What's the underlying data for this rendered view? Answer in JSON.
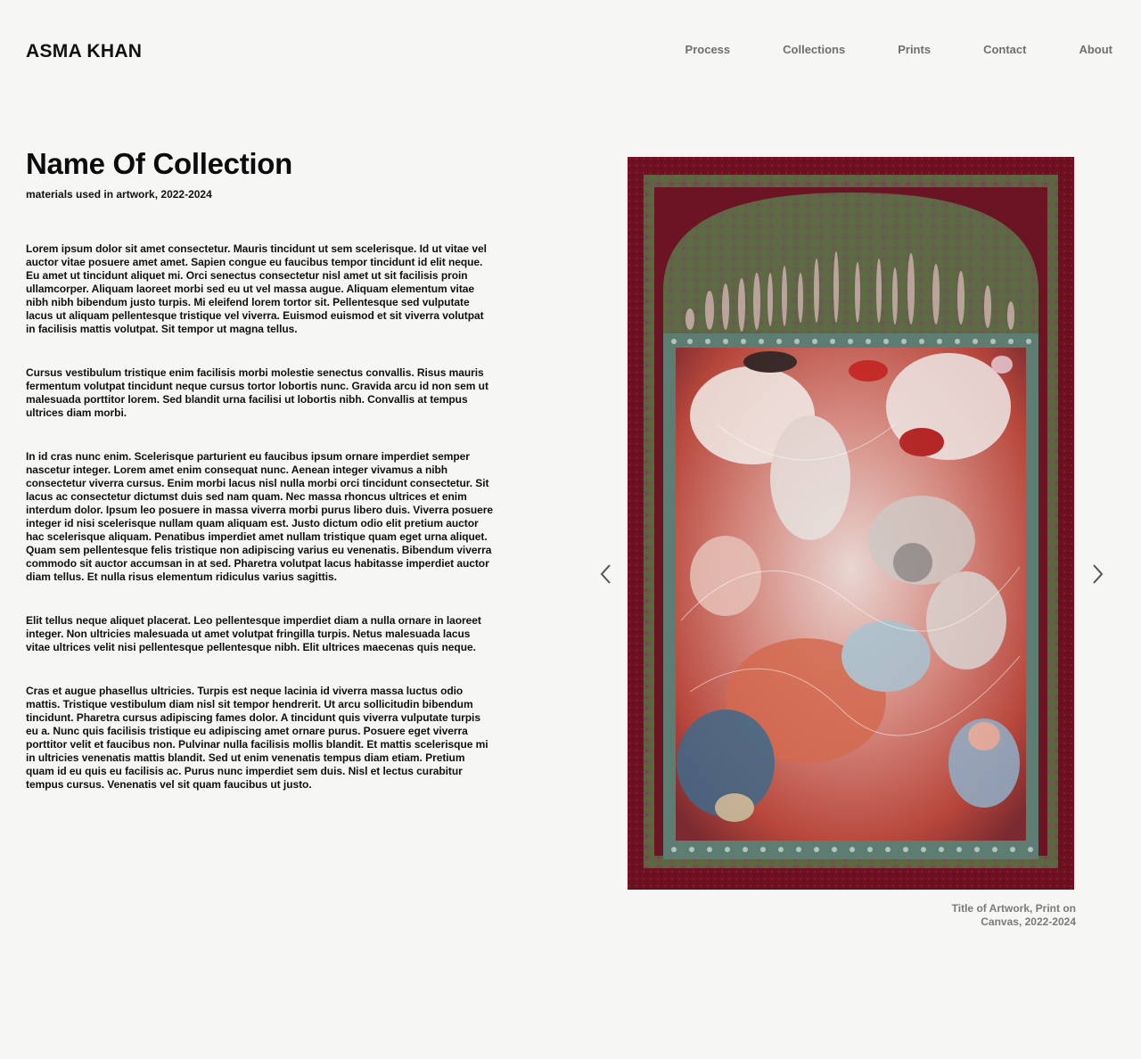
{
  "header": {
    "brand": "ASMA KHAN",
    "nav": [
      {
        "label": "Process"
      },
      {
        "label": "Collections"
      },
      {
        "label": "Prints"
      },
      {
        "label": "Contact"
      },
      {
        "label": "About"
      }
    ]
  },
  "collection": {
    "title": "Name Of Collection",
    "meta": "materials used in artwork, 2022-2024",
    "paragraphs": [
      "Lorem ipsum dolor sit amet consectetur. Mauris tincidunt ut sem scelerisque. Id ut vitae vel auctor vitae posuere amet amet. Sapien congue eu faucibus tempor tincidunt id elit neque. Eu amet ut tincidunt aliquet mi. Orci senectus consectetur nisl amet ut sit facilisis proin ullamcorper. Aliquam laoreet morbi sed eu ut vel massa augue. Aliquam elementum vitae nibh nibh bibendum justo turpis. Mi eleifend lorem tortor sit. Pellentesque sed vulputate lacus ut aliquam pellentesque tristique vel viverra. Euismod euismod et sit viverra volutpat in facilisis mattis volutpat. Sit tempor ut magna tellus.",
      "Cursus vestibulum tristique enim facilisis morbi molestie senectus convallis. Risus mauris fermentum volutpat tincidunt neque cursus tortor lobortis nunc. Gravida arcu id non sem ut malesuada porttitor lorem. Sed blandit urna facilisi ut lobortis nibh. Convallis at tempus ultrices diam morbi.",
      "In id cras nunc enim. Scelerisque parturient eu faucibus ipsum ornare imperdiet semper nascetur integer. Lorem amet enim consequat nunc. Aenean integer vivamus a nibh consectetur viverra cursus. Enim morbi lacus nisl nulla morbi orci tincidunt consectetur. Sit lacus ac consectetur dictumst duis sed nam quam. Nec massa rhoncus ultrices et enim interdum dolor. Ipsum leo posuere in massa viverra morbi purus libero duis. Viverra posuere integer id nisi scelerisque nullam quam aliquam est. Justo dictum odio elit pretium auctor hac scelerisque aliquam. Penatibus imperdiet amet nullam tristique quam eget urna aliquet. Quam sem pellentesque felis tristique non adipiscing varius eu venenatis. Bibendum viverra commodo sit auctor accumsan in at sed. Pharetra volutpat lacus habitasse imperdiet auctor diam tellus. Et nulla risus elementum ridiculus varius sagittis.",
      "Elit tellus neque aliquet placerat. Leo pellentesque imperdiet diam a nulla ornare in laoreet integer. Non ultricies malesuada ut amet volutpat fringilla turpis. Netus malesuada lacus vitae ultrices velit nisi pellentesque pellentesque nibh. Elit ultrices maecenas quis neque.",
      "Cras et augue phasellus ultricies. Turpis est neque lacinia id viverra massa luctus odio mattis. Tristique vestibulum diam nisl sit tempor hendrerit. Ut arcu sollicitudin bibendum tincidunt. Pharetra cursus adipiscing fames dolor. A tincidunt quis viverra vulputate turpis eu a. Nunc quis facilisis tristique eu adipiscing amet ornare purus. Posuere eget viverra porttitor velit et faucibus non. Pulvinar nulla facilisis mollis blandit. Et mattis scelerisque mi in ultricies venenatis mattis blandit. Sed ut enim venenatis tempus diam etiam. Pretium quam id eu quis eu facilisis ac. Purus nunc imperdiet sem duis. Nisl et lectus curabitur tempus cursus. Venenatis vel sit quam faucibus ut justo."
    ]
  },
  "artwork": {
    "caption_line1": "Title of Artwork, Print on",
    "caption_line2": "Canvas, 2022-2024",
    "prev_icon": "chevron-left-icon",
    "next_icon": "chevron-right-icon"
  },
  "colors": {
    "background": "#f6f6f4",
    "frame": "#6d0f1b",
    "inner_border": "#5e7d72",
    "muted_text": "#7a7a7a"
  }
}
